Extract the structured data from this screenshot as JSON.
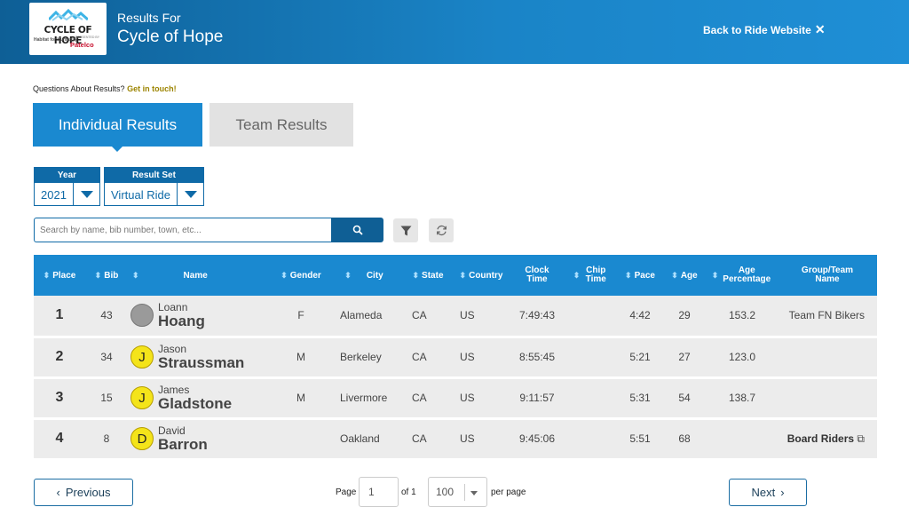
{
  "header": {
    "logo": {
      "line1": "CYCLE OF HOPE",
      "habitat": "Habitat for Humanity",
      "presented": "PRESENTED BY",
      "sponsor": "Patelco"
    },
    "subtitle": "Results For",
    "title": "Cycle of Hope",
    "back_label": "Back to Ride Website"
  },
  "questions": {
    "text": "Questions About Results?",
    "link": "Get in touch!"
  },
  "tabs": [
    {
      "label": "Individual Results",
      "active": true
    },
    {
      "label": "Team Results",
      "active": false
    }
  ],
  "filters": {
    "year": {
      "label": "Year",
      "value": "2021"
    },
    "result_set": {
      "label": "Result Set",
      "value": "Virtual Ride"
    }
  },
  "search": {
    "placeholder": "Search by name, bib number, town, etc..."
  },
  "table": {
    "columns": [
      "Place",
      "Bib",
      "Name",
      "Gender",
      "City",
      "State",
      "Country",
      "Clock Time",
      "Chip Time",
      "Pace",
      "Age",
      "Age Percentage",
      "Group/Team Name"
    ],
    "rows": [
      {
        "place": "1",
        "bib": "43",
        "first": "Loann",
        "last": "Hoang",
        "avatar": "",
        "gender": "F",
        "city": "Alameda",
        "state": "CA",
        "country": "US",
        "clock": "7:49:43",
        "chip": "",
        "pace": "4:42",
        "age": "29",
        "age_pct": "153.2",
        "group": "Team FN Bikers"
      },
      {
        "place": "2",
        "bib": "34",
        "first": "Jason",
        "last": "Straussman",
        "avatar": "J",
        "gender": "M",
        "city": "Berkeley",
        "state": "CA",
        "country": "US",
        "clock": "8:55:45",
        "chip": "",
        "pace": "5:21",
        "age": "27",
        "age_pct": "123.0",
        "group": ""
      },
      {
        "place": "3",
        "bib": "15",
        "first": "James",
        "last": "Gladstone",
        "avatar": "J",
        "gender": "M",
        "city": "Livermore",
        "state": "CA",
        "country": "US",
        "clock": "9:11:57",
        "chip": "",
        "pace": "5:31",
        "age": "54",
        "age_pct": "138.7",
        "group": ""
      },
      {
        "place": "4",
        "bib": "8",
        "first": "David",
        "last": "Barron",
        "avatar": "D",
        "gender": "",
        "city": "Oakland",
        "state": "CA",
        "country": "US",
        "clock": "9:45:06",
        "chip": "",
        "pace": "5:51",
        "age": "68",
        "age_pct": "",
        "group": "Board Riders"
      }
    ]
  },
  "pagination": {
    "previous": "Previous",
    "page_label": "Page",
    "page": "1",
    "of_label": "of 1",
    "per_page": "100",
    "per_page_label": "per page",
    "next": "Next"
  },
  "colors": {
    "brand": "#1a89d0",
    "dark": "#0f5f95",
    "row": "#ececec",
    "avatar": "#f4e41a"
  }
}
